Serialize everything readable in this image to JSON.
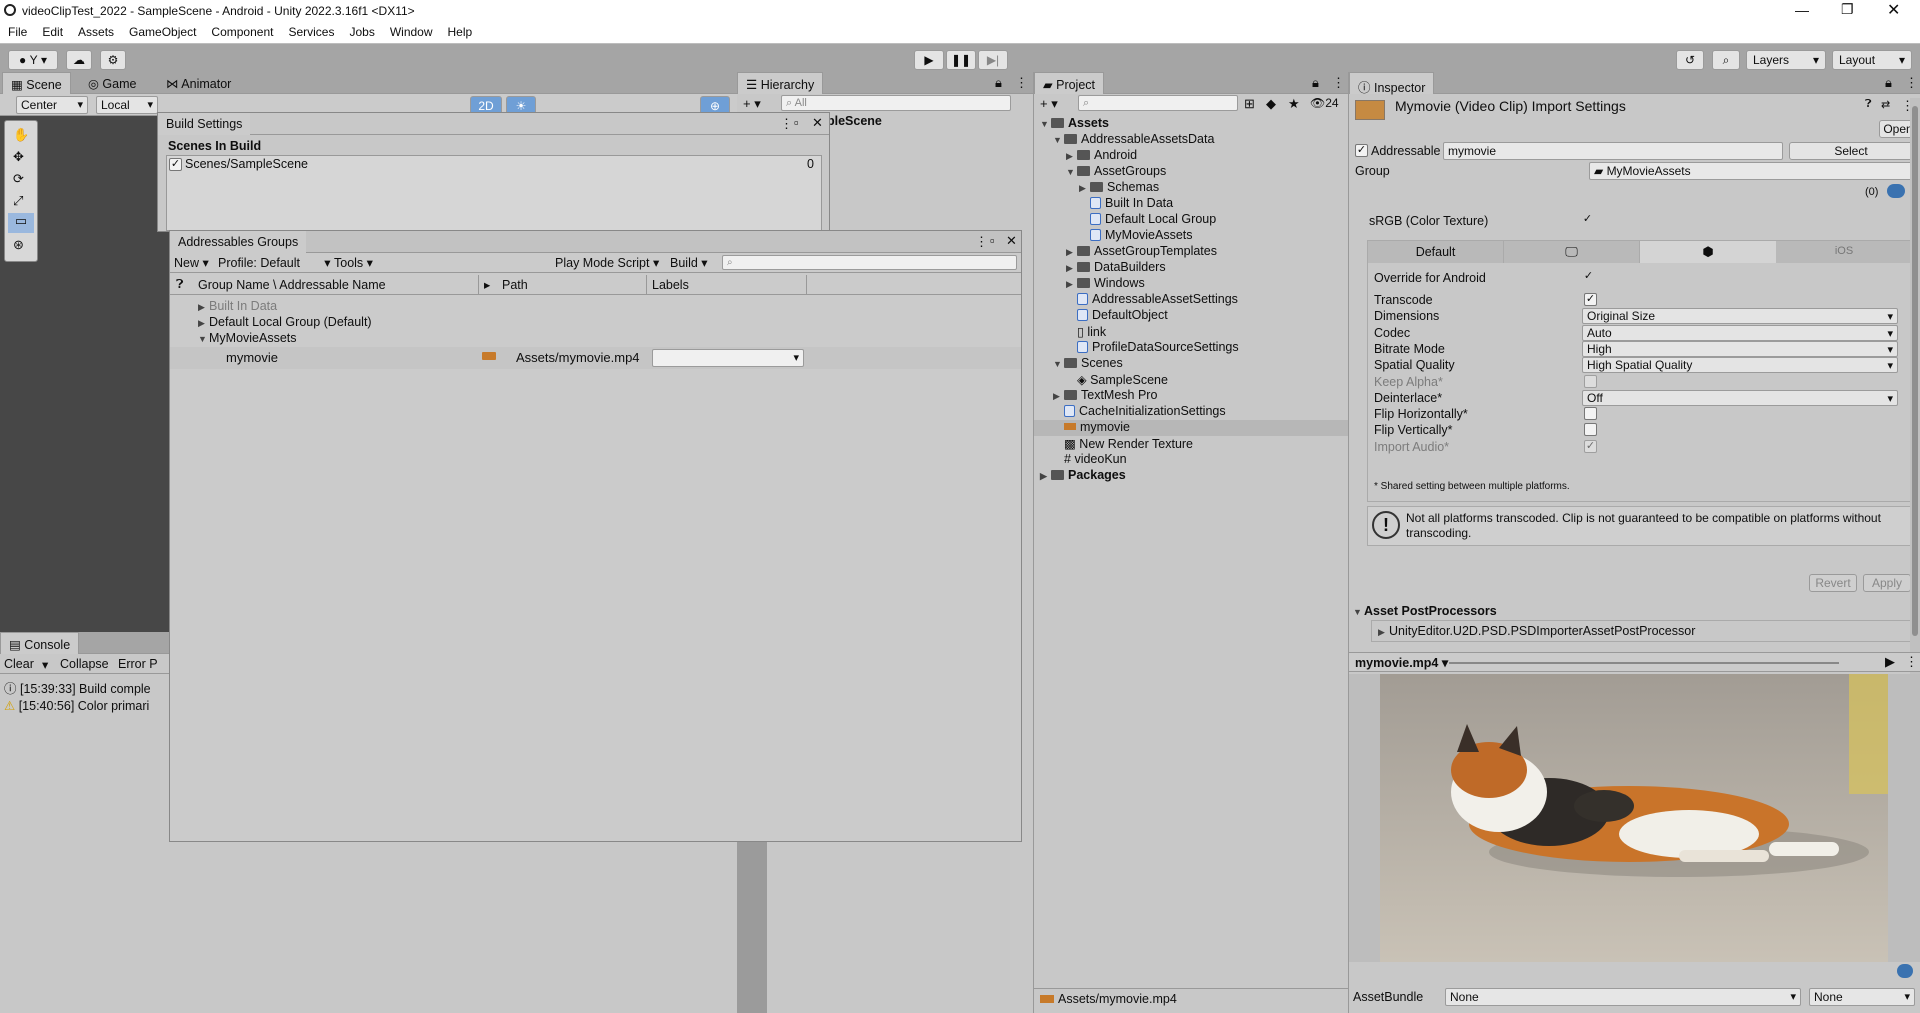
{
  "window": {
    "title": "videoClipTest_2022 - SampleScene - Android - Unity 2022.3.16f1 <DX11>"
  },
  "menu": [
    "File",
    "Edit",
    "Assets",
    "GameObject",
    "Component",
    "Services",
    "Jobs",
    "Window",
    "Help"
  ],
  "toolbar": {
    "account": "Y",
    "layers": "Layers",
    "layout": "Layout"
  },
  "scene_tabs": [
    "Scene",
    "Game",
    "Animator"
  ],
  "scene_toolbar": {
    "pivot": "Center",
    "space": "Local",
    "mode2d": "2D"
  },
  "hierarchy": {
    "tab": "Hierarchy",
    "search_placeholder": "All",
    "scene": "pleScene"
  },
  "build_settings": {
    "tab": "Build Settings",
    "header": "Scenes In Build",
    "scene": "Scenes/SampleScene",
    "index": "0"
  },
  "addressables": {
    "tab": "Addressables Groups",
    "toolbar": {
      "new": "New",
      "profile": "Profile: Default",
      "tools": "Tools",
      "playmode": "Play Mode Script",
      "build": "Build"
    },
    "columns": [
      "Group Name \\ Addressable Name",
      "Path",
      "Labels"
    ],
    "groups": [
      {
        "name": "Built In Data",
        "dim": true
      },
      {
        "name": "Default Local Group (Default)",
        "dim": false
      },
      {
        "name": "MyMovieAssets",
        "dim": false
      }
    ],
    "entry": {
      "name": "mymovie",
      "path": "Assets/mymovie.mp4",
      "labels": ""
    }
  },
  "console": {
    "tab": "Console",
    "buttons": [
      "Clear",
      "Collapse",
      "Error P"
    ],
    "logs": [
      {
        "time": "[15:39:33] Build comple",
        "type": "info"
      },
      {
        "time": "[15:40:56] Color primari",
        "type": "warning"
      }
    ]
  },
  "project": {
    "tab": "Project",
    "hidden_count": "24",
    "tree": [
      {
        "label": "Assets",
        "bold": true,
        "fold": "open",
        "indent": 0,
        "icon": "folder"
      },
      {
        "label": "AddressableAssetsData",
        "fold": "open",
        "indent": 1,
        "icon": "folder"
      },
      {
        "label": "Android",
        "fold": "closed",
        "indent": 2,
        "icon": "folder"
      },
      {
        "label": "AssetGroups",
        "fold": "open",
        "indent": 2,
        "icon": "folder"
      },
      {
        "label": "Schemas",
        "fold": "closed",
        "indent": 3,
        "icon": "folder"
      },
      {
        "label": "Built In Data",
        "fold": "none",
        "indent": 3,
        "icon": "so"
      },
      {
        "label": "Default Local Group",
        "fold": "none",
        "indent": 3,
        "icon": "so"
      },
      {
        "label": "MyMovieAssets",
        "fold": "none",
        "indent": 3,
        "icon": "so"
      },
      {
        "label": "AssetGroupTemplates",
        "fold": "closed",
        "indent": 2,
        "icon": "folder"
      },
      {
        "label": "DataBuilders",
        "fold": "closed",
        "indent": 2,
        "icon": "folder"
      },
      {
        "label": "Windows",
        "fold": "closed",
        "indent": 2,
        "icon": "folder"
      },
      {
        "label": "AddressableAssetSettings",
        "fold": "none",
        "indent": 2,
        "icon": "so"
      },
      {
        "label": "DefaultObject",
        "fold": "none",
        "indent": 2,
        "icon": "so"
      },
      {
        "label": "link",
        "fold": "none",
        "indent": 2,
        "icon": "file"
      },
      {
        "label": "ProfileDataSourceSettings",
        "fold": "none",
        "indent": 2,
        "icon": "so"
      },
      {
        "label": "Scenes",
        "fold": "open",
        "indent": 1,
        "icon": "folder"
      },
      {
        "label": "SampleScene",
        "fold": "none",
        "indent": 2,
        "icon": "unity"
      },
      {
        "label": "TextMesh Pro",
        "fold": "closed",
        "indent": 1,
        "icon": "folder"
      },
      {
        "label": "CacheInitializationSettings",
        "fold": "none",
        "indent": 1,
        "icon": "so"
      },
      {
        "label": "mymovie",
        "fold": "none",
        "indent": 1,
        "icon": "video",
        "selected": true
      },
      {
        "label": "New Render Texture",
        "fold": "none",
        "indent": 1,
        "icon": "rt"
      },
      {
        "label": "videoKun",
        "fold": "none",
        "indent": 1,
        "icon": "cs"
      },
      {
        "label": "Packages",
        "bold": true,
        "fold": "closed",
        "indent": 0,
        "icon": "folder"
      }
    ],
    "footer_path": "Assets/mymovie.mp4"
  },
  "inspector": {
    "tab": "Inspector",
    "title": "Mymovie (Video Clip) Import Settings",
    "open_label": "Open",
    "addressable_label": "Addressable",
    "addressable_name": "mymovie",
    "select_label": "Select",
    "group_label": "Group",
    "group_value": "MyMovieAssets",
    "label_count": "(0)",
    "srgb_label": "sRGB (Color Texture)",
    "platform_tabs": [
      "Default",
      "",
      "",
      "iOS"
    ],
    "override_label": "Override for Android",
    "props": [
      {
        "label": "Transcode",
        "kind": "check",
        "checked": true
      },
      {
        "label": "Dimensions",
        "kind": "dropdown",
        "value": "Original Size"
      },
      {
        "label": "Codec",
        "kind": "dropdown",
        "value": "Auto"
      },
      {
        "label": "Bitrate Mode",
        "kind": "dropdown",
        "value": "High"
      },
      {
        "label": "Spatial Quality",
        "kind": "dropdown",
        "value": "High Spatial Quality"
      },
      {
        "label": "Keep Alpha*",
        "kind": "check",
        "checked": false,
        "disabled": true
      },
      {
        "label": "Deinterlace*",
        "kind": "dropdown",
        "value": "Off"
      },
      {
        "label": "Flip Horizontally*",
        "kind": "check",
        "checked": false
      },
      {
        "label": "Flip Vertically*",
        "kind": "check",
        "checked": false
      },
      {
        "label": "Import Audio*",
        "kind": "check",
        "checked": true,
        "disabled": true
      }
    ],
    "shared_note": "* Shared setting between multiple platforms.",
    "warning": "Not all platforms transcoded. Clip is not guaranteed to be compatible on platforms without transcoding.",
    "revert_label": "Revert",
    "apply_label": "Apply",
    "postprocessors_label": "Asset PostProcessors",
    "postprocessor_item": "UnityEditor.U2D.PSD.PSDImporterAssetPostProcessor",
    "preview_name": "mymovie.mp4",
    "assetbundle_label": "AssetBundle",
    "assetbundle_value": "None",
    "assetbundle_variant": "None"
  },
  "colors": {
    "selection": "#3a72b0",
    "panel": "#c8c8c8",
    "tabbar": "#a5a5a5"
  }
}
